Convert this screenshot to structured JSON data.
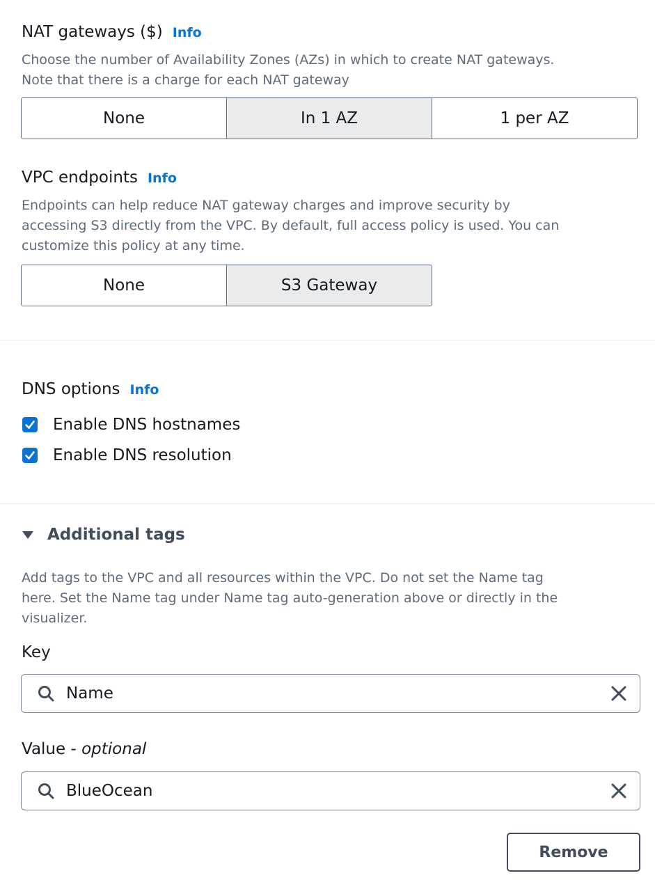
{
  "nat": {
    "title": "NAT gateways ($)",
    "info": "Info",
    "desc_line1": "Choose the number of Availability Zones (AZs) in which to create NAT gateways.",
    "desc_line2": "Note that there is a charge for each NAT gateway",
    "options": [
      "None",
      "In 1 AZ",
      "1 per AZ"
    ],
    "selected": "In 1 AZ"
  },
  "endpoints": {
    "title": "VPC endpoints",
    "info": "Info",
    "desc_line1": "Endpoints can help reduce NAT gateway charges and improve security by",
    "desc_line2": "accessing S3 directly from the VPC. By default, full access policy is used. You can",
    "desc_line3": "customize this policy at any time.",
    "options": [
      "None",
      "S3 Gateway"
    ],
    "selected": "S3 Gateway"
  },
  "dns": {
    "title": "DNS options",
    "info": "Info",
    "hostnames_label": "Enable DNS hostnames",
    "hostnames_checked": true,
    "resolution_label": "Enable DNS resolution",
    "resolution_checked": true
  },
  "tags": {
    "title": "Additional tags",
    "desc_line1": "Add tags to the VPC and all resources within the VPC. Do not set the Name tag",
    "desc_line2": "here. Set the Name tag under Name tag auto-generation above or directly in the",
    "desc_line3": "visualizer.",
    "key_label": "Key",
    "key_value": "Name",
    "value_label": "Value - ",
    "value_label_optional": "optional",
    "value_value": "BlueOcean",
    "remove_label": "Remove"
  },
  "colors": {
    "link": "#0972d3",
    "selected_segment": "#e9ebed",
    "text": "#16191f",
    "secondary_text": "#5f6b7a"
  }
}
